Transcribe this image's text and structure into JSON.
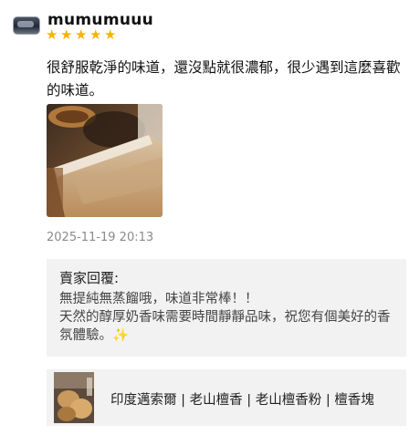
{
  "review": {
    "username": "mumumuuu",
    "rating": 5,
    "rating_max": 5,
    "text": "很舒服乾淨的味道，還沒點就很濃郁，很少遇到這麼喜歡的味道。",
    "date": "2025-11-19 20:13"
  },
  "seller_reply": {
    "title": "賣家回覆:",
    "line1": "無提純無蒸餾哦，味道非常棒！！",
    "line2": "天然的醇厚奶香味需要時間靜靜品味，祝您有個美好的香氛體驗。✨"
  },
  "product": {
    "name": "印度邁索爾 | 老山檀香 | 老山檀香粉 | 檀香塊"
  },
  "colors": {
    "star": "#f5b400",
    "reply_bg": "#f2f2f2",
    "date_text": "#8a8a8a"
  }
}
